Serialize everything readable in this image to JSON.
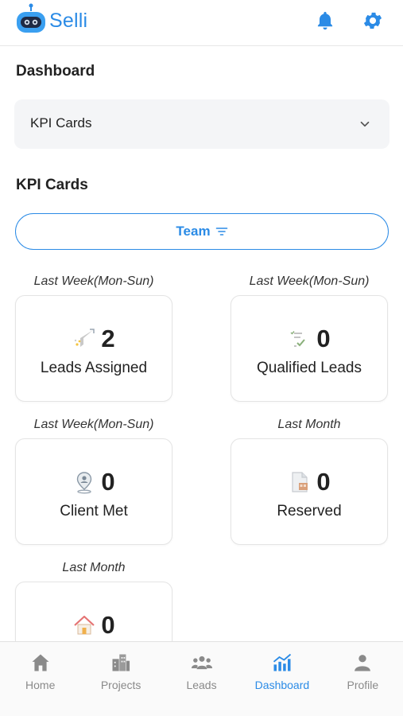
{
  "app": {
    "logo_text": "Selli"
  },
  "header": {
    "bell_icon": "bell-icon",
    "gear_icon": "gear-icon",
    "accent": "#2b8be6"
  },
  "dashboard": {
    "title": "Dashboard"
  },
  "selector": {
    "value": "KPI Cards",
    "icon": "chevron-down-icon"
  },
  "kpi_section": {
    "title": "KPI Cards"
  },
  "filter": {
    "label": "Team",
    "icon": "filter-icon"
  },
  "cards": [
    {
      "period": "Last Week(Mon-Sun)",
      "value": "2",
      "label": "Leads Assigned",
      "icon": "funnel-icon"
    },
    {
      "period": "Last Week(Mon-Sun)",
      "value": "0",
      "label": "Qualified Leads",
      "icon": "checklist-icon"
    },
    {
      "period": "Last Week(Mon-Sun)",
      "value": "0",
      "label": "Client Met",
      "icon": "location-person-icon"
    },
    {
      "period": "Last Month",
      "value": "0",
      "label": "Reserved",
      "icon": "document-icon"
    },
    {
      "period": "Last Month",
      "value": "0",
      "label": "",
      "icon": "house-icon"
    }
  ],
  "nav": [
    {
      "label": "Home",
      "icon": "home-icon",
      "active": false
    },
    {
      "label": "Projects",
      "icon": "buildings-icon",
      "active": false
    },
    {
      "label": "Leads",
      "icon": "people-icon",
      "active": false
    },
    {
      "label": "Dashboard",
      "icon": "chart-icon",
      "active": true
    },
    {
      "label": "Profile",
      "icon": "person-icon",
      "active": false
    }
  ]
}
